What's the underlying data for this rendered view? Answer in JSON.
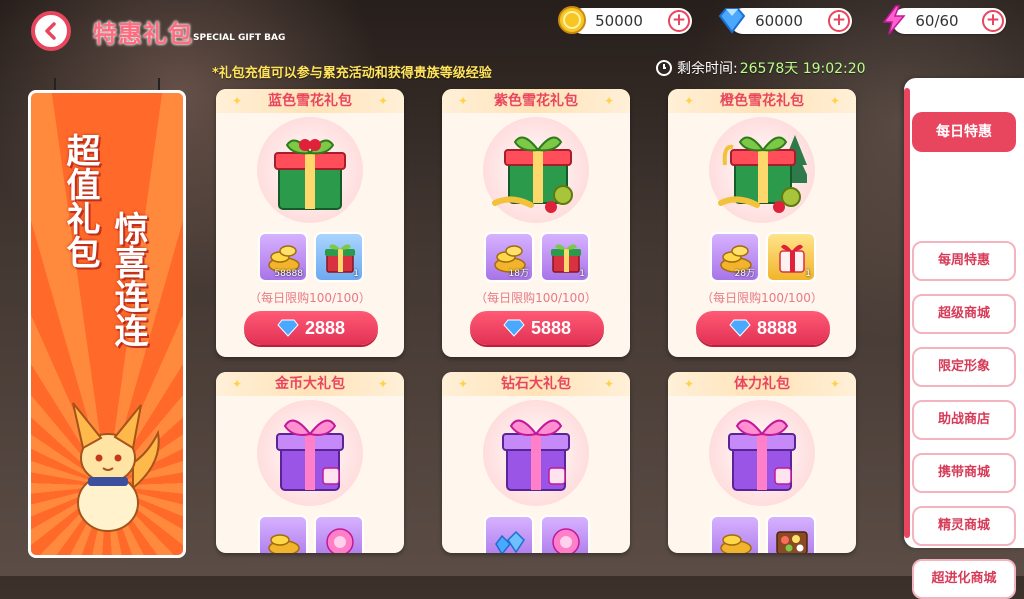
{
  "header": {
    "title": "特惠礼包",
    "subtitle": "SPECIAL GIFT BAG"
  },
  "resources": [
    {
      "name": "coin",
      "value": "50000",
      "icon": "coin-icon"
    },
    {
      "name": "diamond",
      "value": "60000",
      "icon": "diamond-icon"
    },
    {
      "name": "stamina",
      "value": "60/60",
      "icon": "lightning-icon"
    }
  ],
  "notice": "*礼包充值可以参与累充活动和获得贵族等级经验",
  "timer": {
    "label": "剩余时间:",
    "value": "26578天 19:02:20"
  },
  "banner": {
    "line1": "超值礼包",
    "line2": "惊喜连连"
  },
  "cards": [
    {
      "title": "蓝色雪花礼包",
      "limit": "（每日限购100/100）",
      "price": "2888",
      "items": [
        {
          "qty": "58888",
          "icon": "gold-coins-icon",
          "bg": "purple"
        },
        {
          "qty": "1",
          "icon": "green-gift-icon",
          "bg": "blue"
        }
      ]
    },
    {
      "title": "紫色雪花礼包",
      "limit": "（每日限购100/100）",
      "price": "5888",
      "items": [
        {
          "qty": "18万",
          "icon": "gold-coins-icon",
          "bg": "purple"
        },
        {
          "qty": "1",
          "icon": "green-gift-icon",
          "bg": "purple"
        }
      ]
    },
    {
      "title": "橙色雪花礼包",
      "limit": "（每日限购100/100）",
      "price": "8888",
      "items": [
        {
          "qty": "28万",
          "icon": "gold-coins-icon",
          "bg": "purple"
        },
        {
          "qty": "1",
          "icon": "red-gift-icon",
          "bg": "gold"
        }
      ]
    },
    {
      "title": "金币大礼包",
      "items": [
        {
          "icon": "gold-coins-icon",
          "bg": "purple"
        },
        {
          "icon": "pink-orb-icon",
          "bg": "purple"
        }
      ]
    },
    {
      "title": "钻石大礼包",
      "items": [
        {
          "icon": "blue-gems-icon",
          "bg": "purple"
        },
        {
          "icon": "pink-orb-icon",
          "bg": "purple"
        }
      ]
    },
    {
      "title": "体力礼包",
      "items": [
        {
          "icon": "gold-coins-icon",
          "bg": "purple"
        },
        {
          "icon": "food-box-icon",
          "bg": "purple"
        }
      ]
    }
  ],
  "tabs": [
    "每日特惠",
    "每周特惠",
    "超级商城",
    "限定形象",
    "助战商店",
    "携带商城",
    "精灵商城",
    "超进化商城"
  ],
  "active_tab": "每日特惠",
  "colors": {
    "accent": "#e8465f",
    "notice": "#ffe45c",
    "timer_value": "#b9ff8a"
  }
}
